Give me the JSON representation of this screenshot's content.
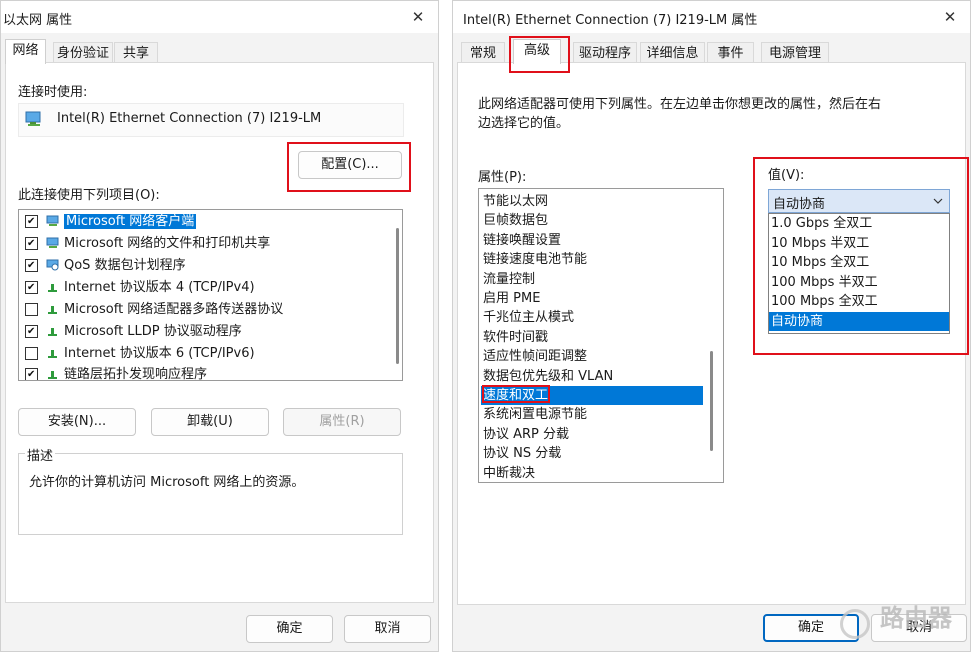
{
  "left_dialog": {
    "title": "以太网 属性",
    "close": "✕",
    "tabs": [
      "网络",
      "身份验证",
      "共享"
    ],
    "connect_using_label": "连接时使用:",
    "adapter_name": "Intel(R) Ethernet Connection (7) I219-LM",
    "configure_button": "配置(C)...",
    "items_label": "此连接使用下列项目(O):",
    "components": [
      {
        "label": "Microsoft 网络客户端",
        "checked": true,
        "icon": "network-client-icon"
      },
      {
        "label": "Microsoft 网络的文件和打印机共享",
        "checked": true,
        "icon": "file-printer-sharing-icon"
      },
      {
        "label": "QoS 数据包计划程序",
        "checked": true,
        "icon": "qos-scheduler-icon"
      },
      {
        "label": "Internet 协议版本 4 (TCP/IPv4)",
        "checked": true,
        "icon": "protocol-icon"
      },
      {
        "label": "Microsoft 网络适配器多路传送器协议",
        "checked": false,
        "icon": "protocol-icon"
      },
      {
        "label": "Microsoft LLDP 协议驱动程序",
        "checked": true,
        "icon": "protocol-icon"
      },
      {
        "label": "Internet 协议版本 6 (TCP/IPv6)",
        "checked": false,
        "icon": "protocol-icon"
      },
      {
        "label": "链路层拓扑发现响应程序",
        "checked": true,
        "icon": "protocol-icon"
      }
    ],
    "install_button": "安装(N)...",
    "uninstall_button": "卸载(U)",
    "properties_button": "属性(R)",
    "description_title": "描述",
    "description_text": "允许你的计算机访问 Microsoft 网络上的资源。",
    "ok_button": "确定",
    "cancel_button": "取消"
  },
  "right_dialog": {
    "title": "Intel(R) Ethernet Connection (7) I219-LM 属性",
    "close": "✕",
    "tabs": [
      "常规",
      "高级",
      "驱动程序",
      "详细信息",
      "事件",
      "电源管理"
    ],
    "intro_line1": "此网络适配器可使用下列属性。在左边单击你想更改的属性，然后在右",
    "intro_line2": "边选择它的值。",
    "property_label": "属性(P):",
    "properties": [
      "节能以太网",
      "巨帧数据包",
      "链接唤醒设置",
      "链接速度电池节能",
      "流量控制",
      "启用 PME",
      "千兆位主从模式",
      "软件时间戳",
      "适应性帧间距调整",
      "数据包优先级和 VLAN",
      "速度和双工",
      "系统闲置电源节能",
      "协议 ARP 分载",
      "协议 NS 分载",
      "中断裁决"
    ],
    "selected_property_index": 10,
    "value_label": "值(V):",
    "value_selected": "自动协商",
    "value_options": [
      "1.0 Gbps 全双工",
      "10 Mbps 半双工",
      "10 Mbps 全双工",
      "100 Mbps 半双工",
      "100 Mbps 全双工",
      "自动协商"
    ],
    "selected_value_index": 5,
    "ok_button": "确定",
    "cancel_button": "取消"
  },
  "watermark": "路由器",
  "colors": {
    "highlight": "#e0101a",
    "selection": "#0078d7",
    "accent": "#0067c0"
  }
}
